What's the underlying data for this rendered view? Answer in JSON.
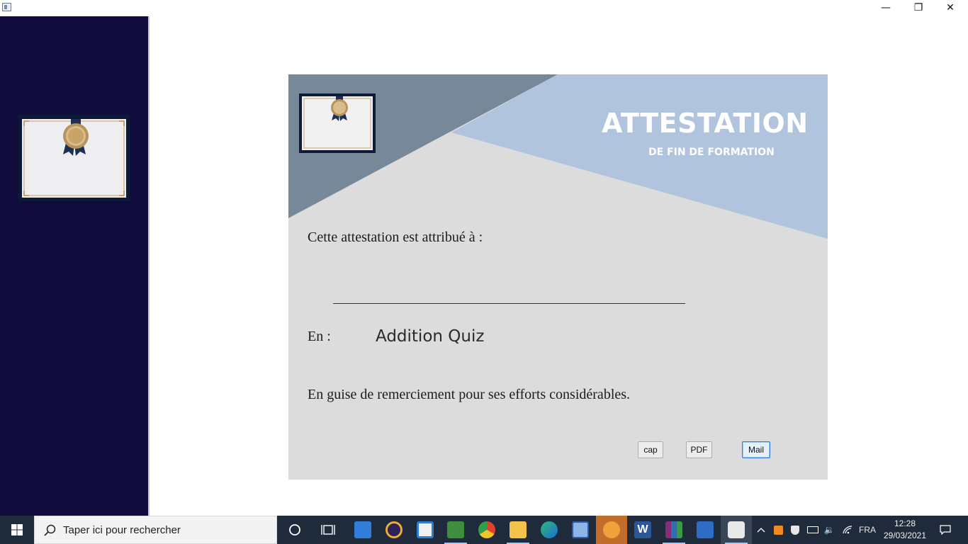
{
  "window": {
    "minimize_glyph": "—",
    "maximize_glyph": "❐",
    "close_glyph": "✕"
  },
  "certificate": {
    "title": "ATTESTATION",
    "subtitle": "DE FIN DE FORMATION",
    "attributed_to": "Cette attestation est attribué à :",
    "en_label": "En :",
    "course_name": "Addition Quiz",
    "thanks": "En guise de remerciement pour ses efforts considérables."
  },
  "buttons": {
    "cap": "cap",
    "pdf": "PDF",
    "mail": "Mail"
  },
  "taskbar": {
    "search_placeholder": "Taper ici pour rechercher",
    "language": "FRA",
    "time": "12:28",
    "date": "29/03/2021",
    "icons": [
      "windows-start-icon",
      "search-icon",
      "cortana-icon",
      "task-view-icon",
      "mail-icon",
      "eclipse-icon",
      "store-icon",
      "spreadsheet-app-icon",
      "chrome-icon",
      "file-explorer-icon",
      "edge-icon",
      "virtualbox-icon",
      "app-orange-icon",
      "word-icon",
      "winrar-icon",
      "photos-icon",
      "java-icon"
    ]
  },
  "colors": {
    "sidebar": "#120c3c",
    "panel": "#dcdcdc",
    "header_dark": "#778899",
    "header_light": "#b0c4de",
    "taskbar": "#1f2a3a"
  }
}
